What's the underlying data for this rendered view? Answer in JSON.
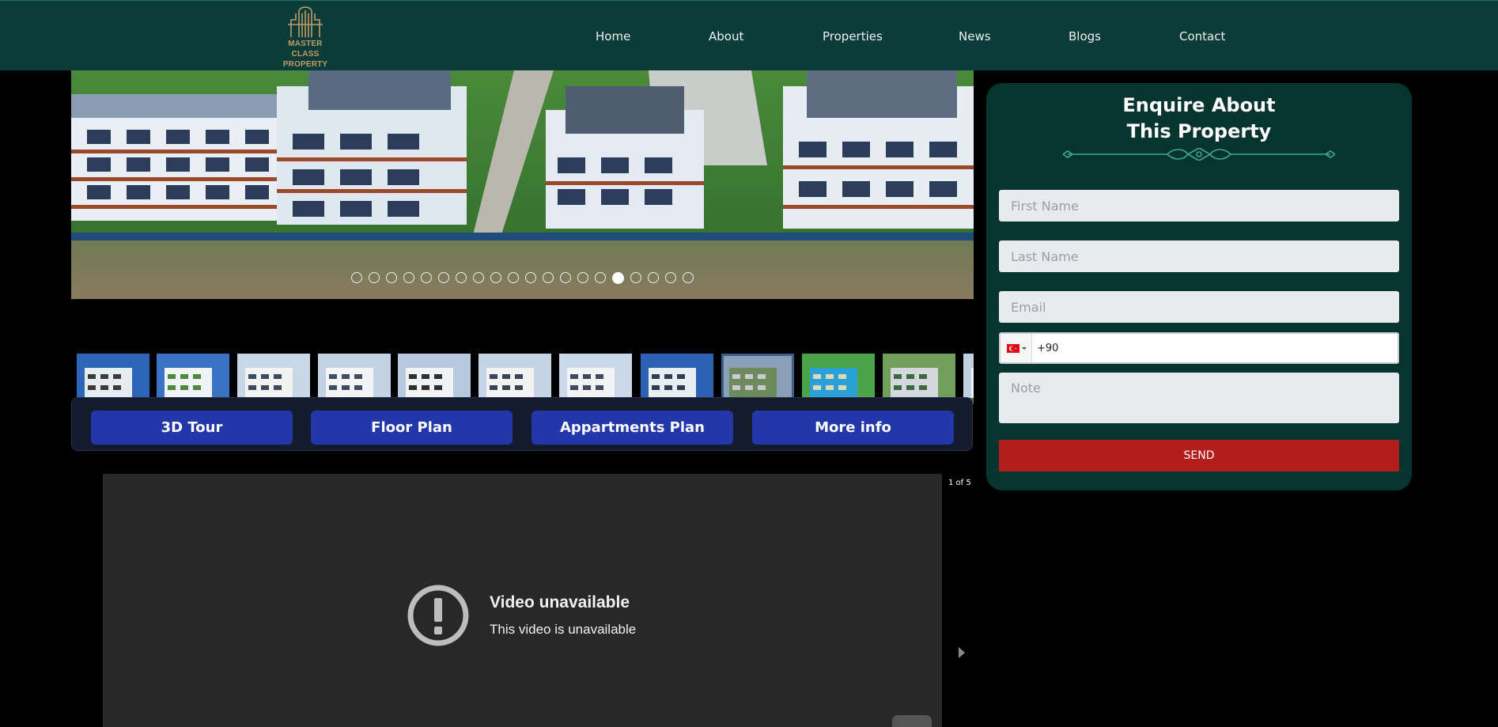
{
  "header": {
    "logo_line1": "MASTER CLASS",
    "logo_line2": "PROPERTY",
    "nav": [
      "Home",
      "About",
      "Properties",
      "News",
      "Blogs",
      "Contact"
    ]
  },
  "slider": {
    "dot_count": 20,
    "active_index": 15
  },
  "thumbnails": {
    "selected_index": 8
  },
  "actions": [
    "3D Tour",
    "Floor Plan",
    "Appartments Plan",
    "More info"
  ],
  "video": {
    "counter": "1 of 5",
    "title": "Video unavailable",
    "subtitle": "This video is unavailable"
  },
  "form": {
    "title_line1": "Enquire About",
    "title_line2": "This Property",
    "first_name_placeholder": "First Name",
    "last_name_placeholder": "Last Name",
    "email_placeholder": "Email",
    "phone_value": "+90",
    "note_placeholder": "Note",
    "send_label": "SEND"
  },
  "colors": {
    "header_bg": "#0a3d3a",
    "panel_bg": "#083430",
    "button_blue": "#2237a9",
    "send_red": "#b51d1d",
    "logo_gold": "#c39a66"
  }
}
